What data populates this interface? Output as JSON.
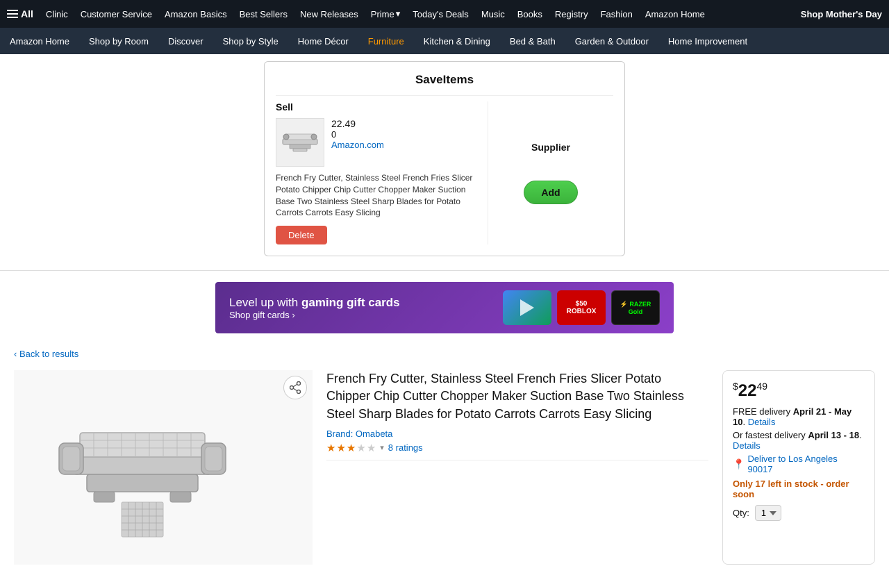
{
  "topNav": {
    "allLabel": "All",
    "items": [
      {
        "label": "Clinic"
      },
      {
        "label": "Customer Service"
      },
      {
        "label": "Amazon Basics"
      },
      {
        "label": "Best Sellers"
      },
      {
        "label": "New Releases"
      },
      {
        "label": "Prime",
        "hasDropdown": true
      },
      {
        "label": "Today's Deals"
      },
      {
        "label": "Music"
      },
      {
        "label": "Books"
      },
      {
        "label": "Registry"
      },
      {
        "label": "Fashion"
      },
      {
        "label": "Amazon Home"
      }
    ],
    "promoLabel": "Shop Mother's Day"
  },
  "secondaryNav": {
    "items": [
      {
        "label": "Amazon Home",
        "active": false
      },
      {
        "label": "Shop by Room",
        "active": false
      },
      {
        "label": "Discover",
        "active": false
      },
      {
        "label": "Shop by Style",
        "active": false
      },
      {
        "label": "Home Décor",
        "active": false
      },
      {
        "label": "Furniture",
        "active": true
      },
      {
        "label": "Kitchen & Dining",
        "active": false
      },
      {
        "label": "Bed & Bath",
        "active": false
      },
      {
        "label": "Garden & Outdoor",
        "active": false
      },
      {
        "label": "Home Improvement",
        "active": false
      }
    ]
  },
  "saveItems": {
    "title": "SaveItems",
    "sellHeader": "Sell",
    "supplierHeader": "Supplier",
    "price": "22.49",
    "zero": "0",
    "amazonLink": "Amazon.com",
    "productTitle": "French Fry Cutter, Stainless Steel French Fries Slicer Potato Chipper Chip Cutter Chopper Maker Suction Base Two Stainless Steel Sharp Blades for Potato Carrots Carrots Easy Slicing",
    "deleteLabel": "Delete",
    "addLabel": "Add"
  },
  "banner": {
    "levelUpText": "Level up with ",
    "boldText": "gaming gift cards",
    "shopText": "Shop gift cards ›",
    "cards": [
      {
        "label": "Google Play",
        "type": "google"
      },
      {
        "label": "$50 Roblox",
        "type": "roblox"
      },
      {
        "label": "Razer Gold",
        "type": "razer"
      }
    ]
  },
  "backLink": "Back to results",
  "product": {
    "title": "French Fry Cutter, Stainless Steel French Fries Slicer Potato Chipper Chip Cutter Chopper Maker Suction Base Two Stainless Steel Sharp Blades for Potato Carrots Carrots Easy Slicing",
    "brand": "Brand: Omabeta",
    "ratingsCount": "8 ratings",
    "ratingValue": "3.0"
  },
  "buyBox": {
    "priceCurrency": "$",
    "priceWhole": "22",
    "priceFraction": "49",
    "deliveryLabel": "FREE delivery",
    "deliveryDate": "April 21 - May 10",
    "detailsLink1": "Details",
    "fastestLabel": "Or fastest delivery",
    "fastestDate": "April 13 - 18",
    "detailsLink2": "Details",
    "deliverTo": "Deliver to Los Angeles 90017",
    "stockWarning": "Only 17 left in stock - order soon",
    "qtyLabel": "Qty:",
    "qtyValue": "1"
  }
}
